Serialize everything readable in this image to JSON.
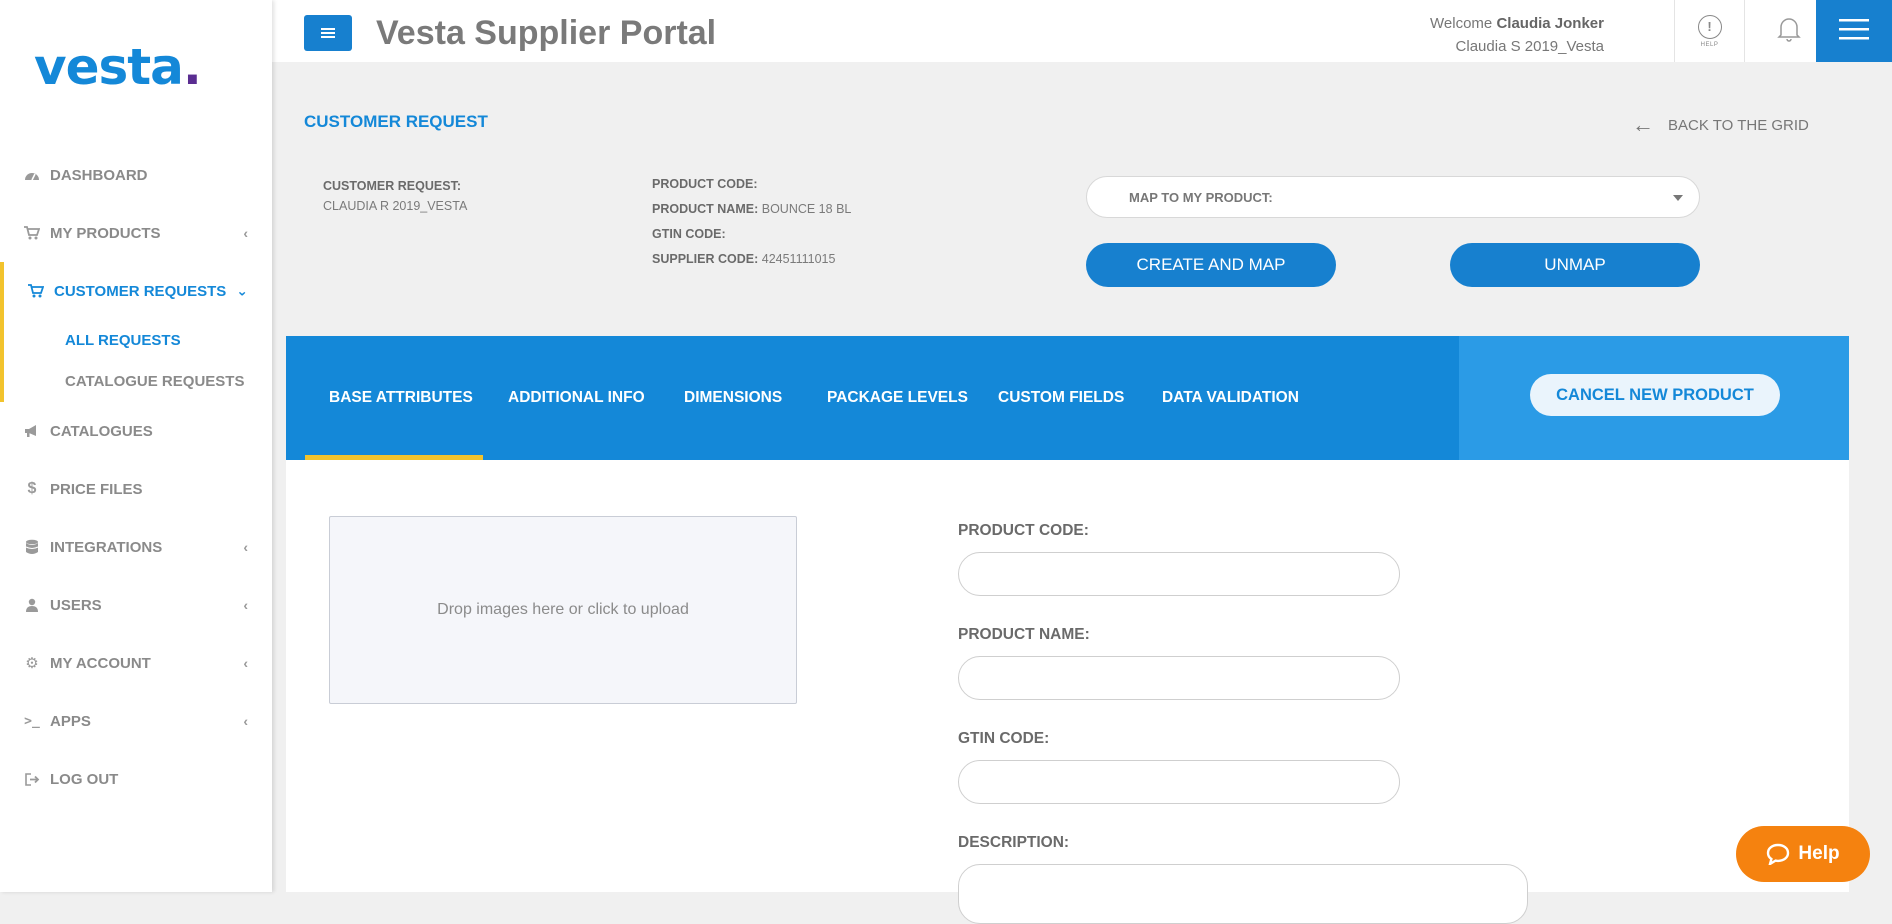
{
  "sidebar": {
    "logo_text": "vesta",
    "logo_dot": ".",
    "items": [
      {
        "label": "DASHBOARD",
        "icon": "dashboard-icon"
      },
      {
        "label": "MY PRODUCTS",
        "icon": "cart-icon"
      },
      {
        "label": "CUSTOMER REQUESTS",
        "icon": "cart-icon",
        "active": true,
        "sub": [
          {
            "label": "ALL REQUESTS",
            "active": true
          },
          {
            "label": "CATALOGUE REQUESTS"
          }
        ]
      },
      {
        "label": "CATALOGUES",
        "icon": "megaphone-icon"
      },
      {
        "label": "PRICE FILES",
        "icon": "dollar-icon"
      },
      {
        "label": "INTEGRATIONS",
        "icon": "database-icon"
      },
      {
        "label": "USERS",
        "icon": "user-icon"
      },
      {
        "label": "MY ACCOUNT",
        "icon": "gear-icon"
      },
      {
        "label": "APPS",
        "icon": "terminal-icon"
      },
      {
        "label": "LOG OUT",
        "icon": "logout-icon"
      }
    ]
  },
  "header": {
    "title": "Vesta Supplier Portal",
    "welcome_prefix": "Welcome",
    "user_name": "Claudia Jonker",
    "account": "Claudia S 2019_Vesta",
    "help_label": "HELP"
  },
  "request": {
    "section_title": "CUSTOMER REQUEST",
    "back_label": "BACK TO THE GRID",
    "customer_request_label": "CUSTOMER REQUEST:",
    "customer_request_value": "CLAUDIA R 2019_VESTA",
    "product_code_label": "PRODUCT CODE:",
    "product_code_value": "",
    "product_name_label": "PRODUCT NAME:",
    "product_name_value": "BOUNCE 18 BL",
    "gtin_label": "GTIN CODE:",
    "gtin_value": "",
    "supplier_code_label": "SUPPLIER CODE:",
    "supplier_code_value": "42451111015",
    "map_placeholder": "MAP TO MY PRODUCT:",
    "create_map_label": "CREATE AND MAP",
    "unmap_label": "UNMAP"
  },
  "tabs": {
    "items": [
      "BASE ATTRIBUTES",
      "ADDITIONAL INFO",
      "DIMENSIONS",
      "PACKAGE LEVELS",
      "CUSTOM FIELDS",
      "DATA VALIDATION"
    ],
    "active_index": 0,
    "cancel_label": "CANCEL NEW PRODUCT"
  },
  "form": {
    "dropzone_text": "Drop images here or click to upload",
    "product_code_label": "PRODUCT CODE:",
    "product_name_label": "PRODUCT NAME:",
    "gtin_label": "GTIN CODE:",
    "description_label": "DESCRIPTION:"
  },
  "help_widget": {
    "label": "Help"
  },
  "colors": {
    "primary": "#1488d8",
    "accent": "#f2c32d",
    "help": "#f5820f"
  }
}
